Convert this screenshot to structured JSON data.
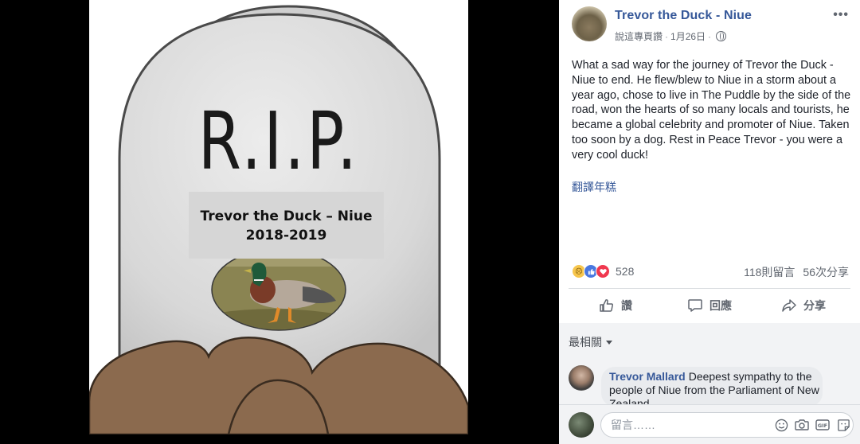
{
  "photo": {
    "headline": "R.I.P.",
    "name_line": "Trevor the Duck – Niue",
    "dates_line": "2018-2019"
  },
  "post": {
    "author": "Trevor the Duck - Niue",
    "meta_label": "說這專頁讚",
    "date": "1月26日",
    "more_label": "•••",
    "text": "What a sad way for the journey of Trevor the Duck - Niue to end. He flew/blew to Niue in a storm about a year ago, chose to live in The Puddle by the side of the road, won the hearts of so many locals and tourists, he became a global celebrity and promoter of Niue. Taken too soon by a dog. Rest in Peace Trevor - you were a very cool duck!",
    "translate_label": "翻譯年糕",
    "reaction_count": "528",
    "comments_count": "118則留言",
    "shares_count": "56次分享",
    "icons": [
      "sad-reaction",
      "like-reaction",
      "love-reaction",
      "globe-icon",
      "more-icon"
    ]
  },
  "actions": {
    "like": "讚",
    "comment": "回應",
    "share": "分享"
  },
  "comments": {
    "sort_label": "最相關",
    "items": [
      {
        "author": "Trevor Mallard",
        "text": "Deepest sympathy to the people of Niue from the Parliament of New Zealand"
      }
    ],
    "composer_placeholder": "留言……"
  },
  "colors": {
    "link": "#365899",
    "tombstone": "#d9d9d9",
    "dirt": "#8b6a4e"
  }
}
